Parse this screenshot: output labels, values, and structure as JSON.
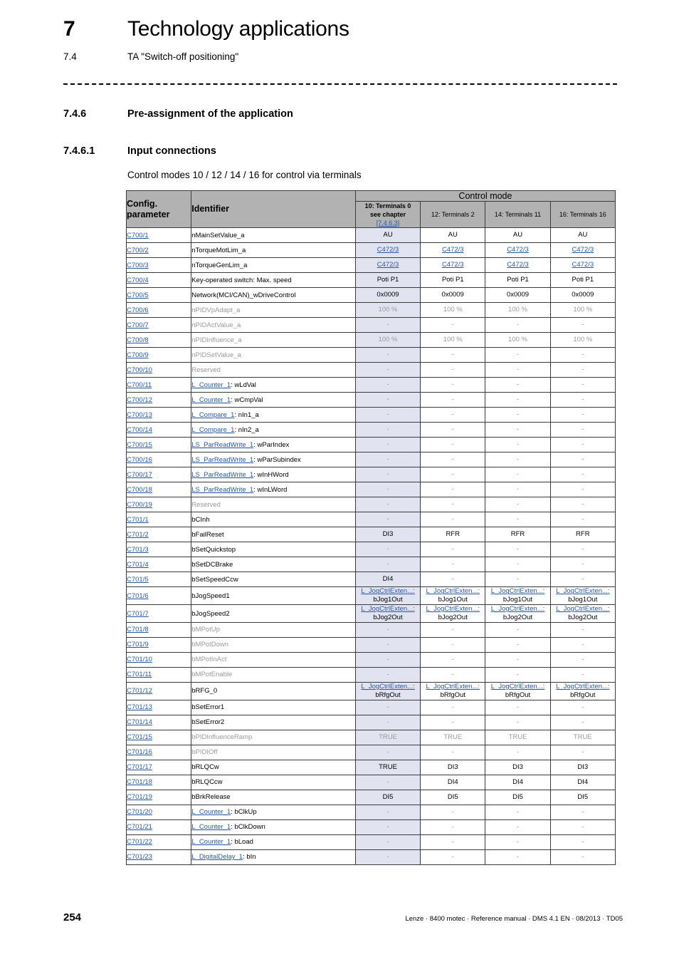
{
  "header": {
    "chapter_number": "7",
    "chapter_title": "Technology applications",
    "section_number": "7.4",
    "section_title": "TA \"Switch-off positioning\""
  },
  "sections": [
    {
      "number": "7.4.6",
      "title": "Pre-assignment of the application"
    },
    {
      "number": "7.4.6.1",
      "title": "Input connections"
    }
  ],
  "intro_text": "Control modes 10 / 12 / 14 / 16 for control via terminals",
  "table": {
    "headers": {
      "config_parameter": "Config. parameter",
      "identifier": "Identifier",
      "control_mode": "Control mode",
      "modes": [
        {
          "label": "10: Terminals 0",
          "note": "see chapter",
          "chapter_link": "[7.4.6.3]",
          "bold": true,
          "highlight": true
        },
        {
          "label": "12: Terminals 2",
          "note": "",
          "chapter_link": "",
          "bold": false,
          "highlight": false
        },
        {
          "label": "14: Terminals 11",
          "note": "",
          "chapter_link": "",
          "bold": false,
          "highlight": false
        },
        {
          "label": "16: Terminals 16",
          "note": "",
          "chapter_link": "",
          "bold": false,
          "highlight": false
        }
      ]
    },
    "rows": [
      {
        "param": "C700/1",
        "ident": "nMainSetValue_a",
        "ident_link": "",
        "muted": false,
        "values": [
          "AU",
          "AU",
          "AU",
          "AU"
        ],
        "value_kind": "plain"
      },
      {
        "param": "C700/2",
        "ident": "nTorqueMotLim_a",
        "ident_link": "",
        "muted": false,
        "values": [
          "C472/3",
          "C472/3",
          "C472/3",
          "C472/3"
        ],
        "value_kind": "link"
      },
      {
        "param": "C700/3",
        "ident": "nTorqueGenLim_a",
        "ident_link": "",
        "muted": false,
        "values": [
          "C472/3",
          "C472/3",
          "C472/3",
          "C472/3"
        ],
        "value_kind": "link"
      },
      {
        "param": "C700/4",
        "ident": "Key-operated switch: Max. speed",
        "ident_link": "",
        "muted": false,
        "values": [
          "Poti P1",
          "Poti P1",
          "Poti P1",
          "Poti P1"
        ],
        "value_kind": "plain"
      },
      {
        "param": "C700/5",
        "ident": "Network(MCI/CAN)_wDriveControl",
        "ident_link": "",
        "muted": false,
        "values": [
          "0x0009",
          "0x0009",
          "0x0009",
          "0x0009"
        ],
        "value_kind": "plain"
      },
      {
        "param": "C700/6",
        "ident": "nPIDVpAdapt_a",
        "ident_link": "",
        "muted": true,
        "values": [
          "100 %",
          "100 %",
          "100 %",
          "100 %"
        ],
        "value_kind": "muted"
      },
      {
        "param": "C700/7",
        "ident": "nPIDActValue_a",
        "ident_link": "",
        "muted": true,
        "values": [
          "-",
          "-",
          "-",
          "-"
        ],
        "value_kind": "dash"
      },
      {
        "param": "C700/8",
        "ident": "nPIDInfluence_a",
        "ident_link": "",
        "muted": true,
        "values": [
          "100 %",
          "100 %",
          "100 %",
          "100 %"
        ],
        "value_kind": "muted"
      },
      {
        "param": "C700/9",
        "ident": "nPIDSetValue_a",
        "ident_link": "",
        "muted": true,
        "values": [
          "-",
          "-",
          "-",
          "-"
        ],
        "value_kind": "dash"
      },
      {
        "param": "C700/10",
        "ident": "Reserved",
        "ident_link": "",
        "muted": true,
        "values": [
          "-",
          "-",
          "-",
          "-"
        ],
        "value_kind": "dash"
      },
      {
        "param": "C700/11",
        "ident": ": wLdVal",
        "ident_link": "L_Counter_1",
        "muted": false,
        "values": [
          "-",
          "-",
          "-",
          "-"
        ],
        "value_kind": "dash"
      },
      {
        "param": "C700/12",
        "ident": ": wCmpVal",
        "ident_link": "L_Counter_1",
        "muted": false,
        "values": [
          "-",
          "-",
          "-",
          "-"
        ],
        "value_kind": "dash"
      },
      {
        "param": "C700/13",
        "ident": ": nIn1_a",
        "ident_link": "L_Compare_1",
        "muted": false,
        "values": [
          "-",
          "-",
          "-",
          "-"
        ],
        "value_kind": "dash"
      },
      {
        "param": "C700/14",
        "ident": ": nIn2_a",
        "ident_link": "L_Compare_1",
        "muted": false,
        "values": [
          "-",
          "-",
          "-",
          "-"
        ],
        "value_kind": "dash"
      },
      {
        "param": "C700/15",
        "ident": ": wParIndex",
        "ident_link": "LS_ParReadWrite_1",
        "muted": false,
        "values": [
          "-",
          "-",
          "-",
          "-"
        ],
        "value_kind": "dash"
      },
      {
        "param": "C700/16",
        "ident": ": wParSubindex",
        "ident_link": "LS_ParReadWrite_1",
        "muted": false,
        "values": [
          "-",
          "-",
          "-",
          "-"
        ],
        "value_kind": "dash"
      },
      {
        "param": "C700/17",
        "ident": ": wInHWord",
        "ident_link": "LS_ParReadWrite_1",
        "muted": false,
        "values": [
          "-",
          "-",
          "-",
          "-"
        ],
        "value_kind": "dash"
      },
      {
        "param": "C700/18",
        "ident": ": wInLWord",
        "ident_link": "LS_ParReadWrite_1",
        "muted": false,
        "values": [
          "-",
          "-",
          "-",
          "-"
        ],
        "value_kind": "dash"
      },
      {
        "param": "C700/19",
        "ident": "Reserved",
        "ident_link": "",
        "muted": true,
        "values": [
          "-",
          "-",
          "-",
          "-"
        ],
        "value_kind": "dash"
      },
      {
        "param": "C701/1",
        "ident": "bCInh",
        "ident_link": "",
        "muted": false,
        "values": [
          "-",
          "-",
          "-",
          "-"
        ],
        "value_kind": "dash"
      },
      {
        "param": "C701/2",
        "ident": "bFailReset",
        "ident_link": "",
        "muted": false,
        "values": [
          "DI3",
          "RFR",
          "RFR",
          "RFR"
        ],
        "value_kind": "plain"
      },
      {
        "param": "C701/3",
        "ident": "bSetQuickstop",
        "ident_link": "",
        "muted": false,
        "values": [
          "-",
          "-",
          "-",
          "-"
        ],
        "value_kind": "dash"
      },
      {
        "param": "C701/4",
        "ident": "bSetDCBrake",
        "ident_link": "",
        "muted": false,
        "values": [
          "-",
          "-",
          "-",
          "-"
        ],
        "value_kind": "dash"
      },
      {
        "param": "C701/5",
        "ident": "bSetSpeedCcw",
        "ident_link": "",
        "muted": false,
        "values": [
          "DI4",
          "-",
          "-",
          "-"
        ],
        "value_kind": "mixed"
      },
      {
        "param": "C701/6",
        "ident": "bJogSpeed1",
        "ident_link": "",
        "muted": false,
        "values": [
          "bJog1Out",
          "bJog1Out",
          "bJog1Out",
          "bJog1Out"
        ],
        "value_kind": "block",
        "value_link": "L_JogCtrlExten...:"
      },
      {
        "param": "C701/7",
        "ident": "bJogSpeed2",
        "ident_link": "",
        "muted": false,
        "values": [
          "bJog2Out",
          "bJog2Out",
          "bJog2Out",
          "bJog2Out"
        ],
        "value_kind": "block",
        "value_link": "L_JogCtrlExten...:"
      },
      {
        "param": "C701/8",
        "ident": "bMPotUp",
        "ident_link": "",
        "muted": true,
        "values": [
          "-",
          "-",
          "-",
          "-"
        ],
        "value_kind": "dash"
      },
      {
        "param": "C701/9",
        "ident": "bMPotDown",
        "ident_link": "",
        "muted": true,
        "values": [
          "-",
          "-",
          "-",
          "-"
        ],
        "value_kind": "dash"
      },
      {
        "param": "C701/10",
        "ident": "bMPotInAct",
        "ident_link": "",
        "muted": true,
        "values": [
          "-",
          "-",
          "-",
          "-"
        ],
        "value_kind": "dash"
      },
      {
        "param": "C701/11",
        "ident": "bMPotEnable",
        "ident_link": "",
        "muted": true,
        "values": [
          "-",
          "-",
          "-",
          "-"
        ],
        "value_kind": "dash"
      },
      {
        "param": "C701/12",
        "ident": "bRFG_0",
        "ident_link": "",
        "muted": false,
        "values": [
          "bRfgOut",
          "bRfgOut",
          "bRfgOut",
          "bRfgOut"
        ],
        "value_kind": "block",
        "value_link": "L_JogCtrlExten...:"
      },
      {
        "param": "C701/13",
        "ident": "bSetError1",
        "ident_link": "",
        "muted": false,
        "values": [
          "-",
          "-",
          "-",
          "-"
        ],
        "value_kind": "dash"
      },
      {
        "param": "C701/14",
        "ident": "bSetError2",
        "ident_link": "",
        "muted": false,
        "values": [
          "-",
          "-",
          "-",
          "-"
        ],
        "value_kind": "dash"
      },
      {
        "param": "C701/15",
        "ident": "bPIDInfluenceRamp",
        "ident_link": "",
        "muted": true,
        "values": [
          "TRUE",
          "TRUE",
          "TRUE",
          "TRUE"
        ],
        "value_kind": "muted"
      },
      {
        "param": "C701/16",
        "ident": "bPIDIOff",
        "ident_link": "",
        "muted": true,
        "values": [
          "-",
          "-",
          "-",
          "-"
        ],
        "value_kind": "dash"
      },
      {
        "param": "C701/17",
        "ident": "bRLQCw",
        "ident_link": "",
        "muted": false,
        "values": [
          "TRUE",
          "DI3",
          "DI3",
          "DI3"
        ],
        "value_kind": "plain"
      },
      {
        "param": "C701/18",
        "ident": "bRLQCcw",
        "ident_link": "",
        "muted": false,
        "values": [
          "-",
          "DI4",
          "DI4",
          "DI4"
        ],
        "value_kind": "mixed"
      },
      {
        "param": "C701/19",
        "ident": "bBrkRelease",
        "ident_link": "",
        "muted": false,
        "values": [
          "DI5",
          "DI5",
          "DI5",
          "DI5"
        ],
        "value_kind": "plain"
      },
      {
        "param": "C701/20",
        "ident": ": bClkUp",
        "ident_link": "L_Counter_1",
        "muted": false,
        "values": [
          "-",
          "-",
          "-",
          "-"
        ],
        "value_kind": "dash"
      },
      {
        "param": "C701/21",
        "ident": ": bClkDown",
        "ident_link": "L_Counter_1",
        "muted": false,
        "values": [
          "-",
          "-",
          "-",
          "-"
        ],
        "value_kind": "dash"
      },
      {
        "param": "C701/22",
        "ident": ": bLoad",
        "ident_link": "L_Counter_1",
        "muted": false,
        "values": [
          "-",
          "-",
          "-",
          "-"
        ],
        "value_kind": "dash"
      },
      {
        "param": "C701/23",
        "ident": ": bIn",
        "ident_link": "L_DigitalDelay_1",
        "muted": false,
        "values": [
          "-",
          "-",
          "-",
          "-"
        ],
        "value_kind": "dash"
      }
    ]
  },
  "footer": {
    "page_number": "254",
    "text": "Lenze · 8400 motec · Reference manual · DMS 4.1 EN · 08/2013 · TD05"
  },
  "colors": {
    "link": "#2759a8",
    "header_fill": "#b2b2b2",
    "highlight_column": "#e2e3f0",
    "muted_text": "#9a9a9a"
  }
}
